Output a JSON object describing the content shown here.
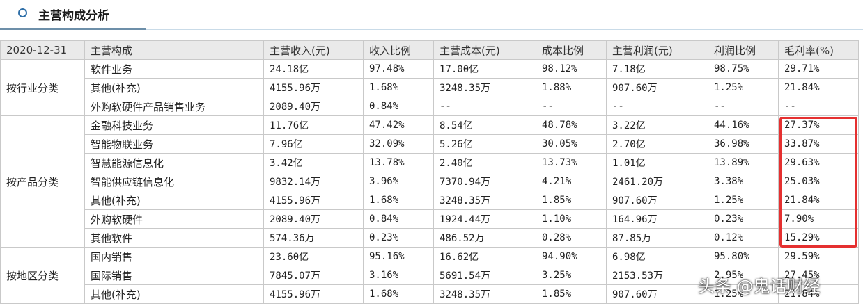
{
  "header": {
    "title": "主营构成分析"
  },
  "table": {
    "columns": [
      "2020-12-31",
      "主营构成",
      "主营收入(元)",
      "收入比例",
      "主营成本(元)",
      "成本比例",
      "主营利润(元)",
      "利润比例",
      "毛利率(%)"
    ],
    "groups": [
      {
        "label": "按行业分类",
        "rows": [
          [
            "软件业务",
            "24.18亿",
            "97.48%",
            "17.00亿",
            "98.12%",
            "7.18亿",
            "98.75%",
            "29.71%"
          ],
          [
            "其他(补充)",
            "4155.96万",
            "1.68%",
            "3248.35万",
            "1.88%",
            "907.60万",
            "1.25%",
            "21.84%"
          ],
          [
            "外购软硬件产品销售业务",
            "2089.40万",
            "0.84%",
            "--",
            "--",
            "--",
            "--",
            "--"
          ]
        ]
      },
      {
        "label": "按产品分类",
        "rows": [
          [
            "金融科技业务",
            "11.76亿",
            "47.42%",
            "8.54亿",
            "48.78%",
            "3.22亿",
            "44.16%",
            "27.37%"
          ],
          [
            "智能物联业务",
            "7.96亿",
            "32.09%",
            "5.26亿",
            "30.05%",
            "2.70亿",
            "36.98%",
            "33.87%"
          ],
          [
            "智慧能源信息化",
            "3.42亿",
            "13.78%",
            "2.40亿",
            "13.73%",
            "1.01亿",
            "13.89%",
            "29.63%"
          ],
          [
            "智能供应链信息化",
            "9832.14万",
            "3.96%",
            "7370.94万",
            "4.21%",
            "2461.20万",
            "3.38%",
            "25.03%"
          ],
          [
            "其他(补充)",
            "4155.96万",
            "1.68%",
            "3248.35万",
            "1.85%",
            "907.60万",
            "1.25%",
            "21.84%"
          ],
          [
            "外购软硬件",
            "2089.40万",
            "0.84%",
            "1924.44万",
            "1.10%",
            "164.96万",
            "0.23%",
            "7.90%"
          ],
          [
            "其他软件",
            "574.36万",
            "0.23%",
            "486.52万",
            "0.28%",
            "87.85万",
            "0.12%",
            "15.29%"
          ]
        ]
      },
      {
        "label": "按地区分类",
        "rows": [
          [
            "国内销售",
            "23.60亿",
            "95.16%",
            "16.62亿",
            "94.90%",
            "6.98亿",
            "95.80%",
            "29.59%"
          ],
          [
            "国际销售",
            "7845.07万",
            "3.16%",
            "5691.54万",
            "3.25%",
            "2153.53万",
            "2.95%",
            "27.45%"
          ],
          [
            "其他(补充)",
            "4155.96万",
            "1.68%",
            "3248.35万",
            "1.85%",
            "907.60万",
            "1.25%",
            "21.84%"
          ]
        ]
      }
    ]
  },
  "highlight": {
    "color": "#e53030"
  },
  "watermark": {
    "text": "头条 @鬼话财经"
  }
}
